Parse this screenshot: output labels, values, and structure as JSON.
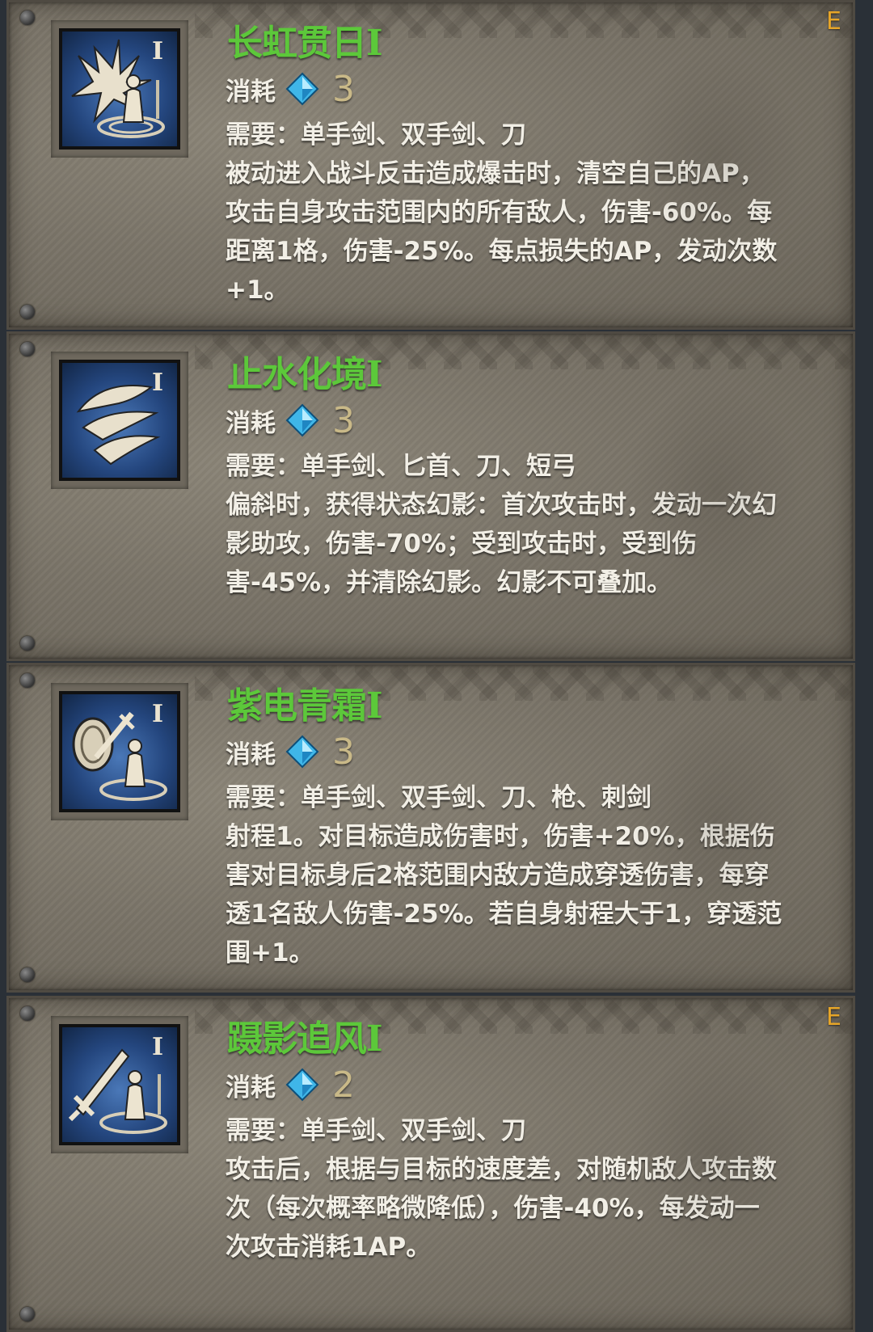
{
  "skills": [
    {
      "name": "长虹贯日I",
      "cost_label": "消耗",
      "cost_value": "3",
      "requirement": "需要：单手剑、双手剑、刀",
      "description": "被动进入战斗反击造成爆击时，清空自己的AP，攻击自身攻击范围内的所有敌人，伤害-60%。每距离1格，伤害-25%。每点损失的AP，发动次数+1。",
      "badge": "E",
      "icon": "burst-figure-icon"
    },
    {
      "name": "止水化境I",
      "cost_label": "消耗",
      "cost_value": "3",
      "requirement": "需要：单手剑、匕首、刀、短弓",
      "description": "偏斜时，获得状态幻影：首次攻击时，发动一次幻影助攻，伤害-70%；受到攻击时，受到伤害-45%，并清除幻影。幻影不可叠加。",
      "badge": "",
      "icon": "phantom-claw-icon"
    },
    {
      "name": "紫电青霜I",
      "cost_label": "消耗",
      "cost_value": "3",
      "requirement": "需要：单手剑、双手剑、刀、枪、刺剑",
      "description": "射程1。对目标造成伤害时，伤害+20%，根据伤害对目标身后2格范围内敌方造成穿透伤害，每穿透1名敌人伤害-25%。若自身射程大于1，穿透范围+1。",
      "badge": "",
      "icon": "shield-sword-figure-icon"
    },
    {
      "name": "蹑影追风I",
      "cost_label": "消耗",
      "cost_value": "2",
      "requirement": "需要：单手剑、双手剑、刀",
      "description": "攻击后，根据与目标的速度差，对随机敌人攻击数次（每次概率略微降低），伤害-40%，每发动一次攻击消耗1AP。",
      "badge": "E",
      "icon": "sword-figure-icon"
    }
  ]
}
